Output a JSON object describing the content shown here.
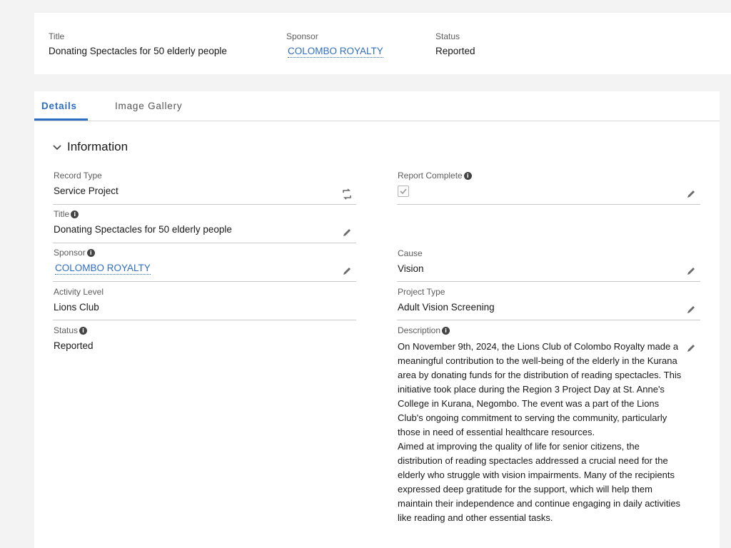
{
  "highlights": {
    "title_label": "Title",
    "title_value": "Donating Spectacles for 50 elderly people",
    "sponsor_label": "Sponsor",
    "sponsor_value": "COLOMBO ROYALTY",
    "status_label": "Status",
    "status_value": "Reported"
  },
  "tabs": {
    "details": "Details",
    "gallery": "Image Gallery"
  },
  "section": {
    "title": "Information"
  },
  "fields": {
    "record_type": {
      "label": "Record Type",
      "value": "Service Project"
    },
    "title": {
      "label": "Title",
      "value": "Donating Spectacles for 50 elderly people"
    },
    "sponsor": {
      "label": "Sponsor",
      "value": "COLOMBO ROYALTY"
    },
    "activity_level": {
      "label": "Activity Level",
      "value": "Lions Club"
    },
    "status": {
      "label": "Status",
      "value": "Reported"
    },
    "report_complete": {
      "label": "Report Complete",
      "checked": true
    },
    "cause": {
      "label": "Cause",
      "value": "Vision"
    },
    "project_type": {
      "label": "Project Type",
      "value": "Adult Vision Screening"
    },
    "description": {
      "label": "Description",
      "paragraph1": "On November 9th, 2024, the Lions Club of Colombo Royalty made a meaningful contribution to the well-being of the elderly in the Kurana area by donating funds for the distribution of reading spectacles. This initiative took place during the Region 3 Project Day at St. Anne's College in Kurana, Negombo. The event was a part of the Lions Club's ongoing commitment to serving the community, particularly those in need of essential healthcare resources.",
      "paragraph2": "Aimed at improving the quality of life for senior citizens, the distribution of reading spectacles addressed a crucial need for the elderly who struggle with vision impairments. Many of the recipients expressed deep gratitude for the support, which will help them maintain their independence and continue engaging in daily activities like reading and other essential tasks."
    }
  },
  "icons": {
    "edit": "pencil-icon",
    "change_record_type": "change-record-type-icon",
    "info": "info-icon",
    "section_toggle": "chevron-down-icon"
  },
  "colors": {
    "accent": "#2e6ec2",
    "background": "#f3f3f3"
  }
}
